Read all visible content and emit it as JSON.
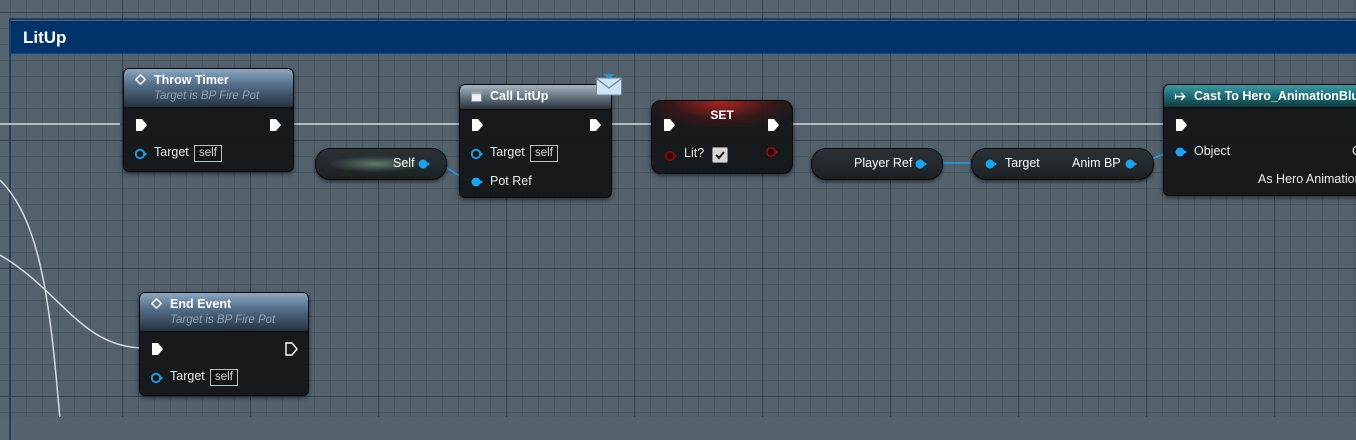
{
  "comment": {
    "title": "LitUp"
  },
  "nodes": {
    "throw_timer": {
      "title": "Throw Timer",
      "subtitle": "Target is BP Fire Pot",
      "target_label": "Target",
      "target_default": "self"
    },
    "self_ref": {
      "label": "Self"
    },
    "call_litup": {
      "title": "Call LitUp",
      "target_label": "Target",
      "target_default": "self",
      "pot_ref_label": "Pot Ref"
    },
    "set_node": {
      "title": "SET",
      "lit_label": "Lit?",
      "lit_value": true
    },
    "player_ref": {
      "label": "Player Ref"
    },
    "get_anim_bp": {
      "target_label": "Target",
      "output_label": "Anim BP"
    },
    "cast_node": {
      "title": "Cast To Hero_AnimationBlue",
      "object_label": "Object",
      "output_label": "As Hero Animation",
      "cut_label": "C"
    },
    "end_event": {
      "title": "End Event",
      "subtitle": "Target is BP Fire Pot",
      "target_label": "Target",
      "target_default": "self"
    }
  },
  "colors": {
    "object_pin": "#1aa3f0",
    "bool_pin": "#8c0b0b",
    "exec_pin": "#ffffff",
    "comment_header": "#00336a",
    "graph_bg": "#57636e"
  },
  "icons": {
    "function": "function-diamond-icon",
    "call": "call-function-icon",
    "message": "envelope-icon",
    "cast": "cast-arrow-icon"
  }
}
